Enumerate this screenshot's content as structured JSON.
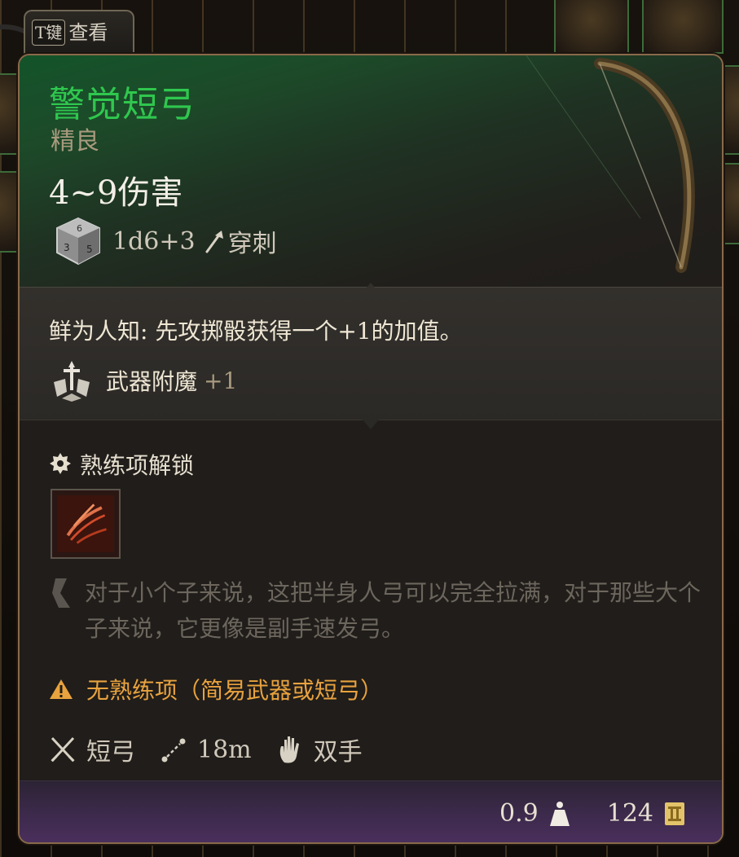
{
  "hint_tab": {
    "key": "T键",
    "label": "查看"
  },
  "item": {
    "name": "警觉短弓",
    "rarity": "精良",
    "damage_range": "4~9伤害",
    "dice_formula": "1d6+3",
    "damage_type": "穿刺",
    "name_color": "#2fc74e"
  },
  "passive": {
    "text": "鲜为人知: 先攻掷骰获得一个+1的加值。",
    "enchant_label": "武器附魔",
    "enchant_value": "+1"
  },
  "proficiency": {
    "label": "熟练项解锁",
    "lore": "对于小个子来说，这把半身人弓可以完全拉满，对于那些大个子来说，它更像是副手速发弓。",
    "warning": "无熟练项（简易武器或短弓）",
    "warning_color": "#e8a23e"
  },
  "properties": [
    {
      "icon": "crossed-swords-icon",
      "label": "短弓"
    },
    {
      "icon": "range-icon",
      "label": "18m"
    },
    {
      "icon": "hand-icon",
      "label": "双手"
    }
  ],
  "footer": {
    "weight": "0.9",
    "value": "124"
  }
}
